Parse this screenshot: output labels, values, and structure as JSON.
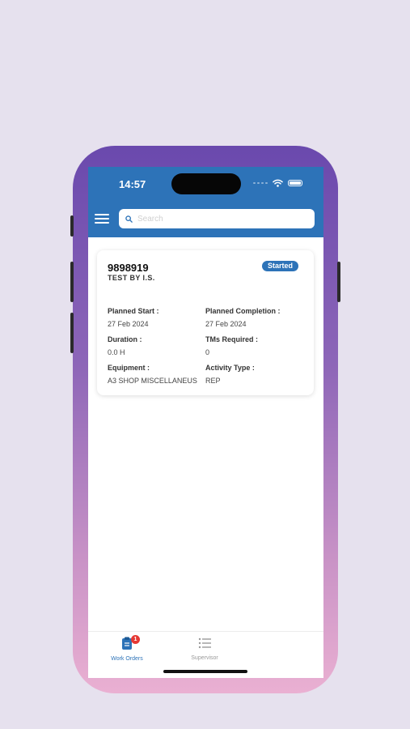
{
  "status_bar": {
    "time": "14:57"
  },
  "header": {
    "menu_icon": "hamburger-icon",
    "search": {
      "placeholder": "Search",
      "value": "",
      "icon": "search-icon"
    },
    "accent_color": "#2d73b8"
  },
  "work_order": {
    "number": "9898919",
    "description": "TEST BY I.S.",
    "status": "Started",
    "planned_start_label": "Planned Start :",
    "planned_start": "27 Feb 2024",
    "planned_completion_label": "Planned Completion :",
    "planned_completion": "27 Feb 2024",
    "duration_label": "Duration :",
    "duration": "0.0 H",
    "tms_required_label": "TMs Required :",
    "tms_required": "0",
    "equipment_label": "Equipment :",
    "equipment": "A3 SHOP MISCELLANEUS",
    "activity_type_label": "Activity Type :",
    "activity_type": "REP"
  },
  "tabs": [
    {
      "label": "Work Orders",
      "icon": "clipboard-icon",
      "badge": "1",
      "active": true
    },
    {
      "label": "Supervisor",
      "icon": "list-icon",
      "active": false
    }
  ]
}
